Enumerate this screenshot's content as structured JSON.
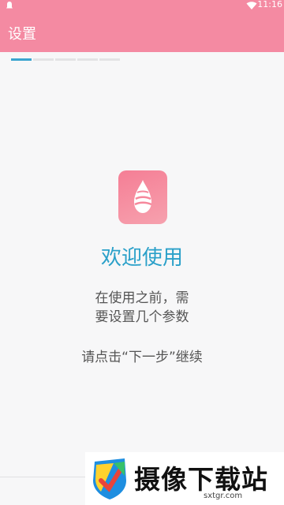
{
  "status_bar": {
    "time": "11:16",
    "left_icon": "notification-icon",
    "wifi_icon": "wifi-icon",
    "color": "#f48aa2"
  },
  "app_bar": {
    "title": "设置",
    "background": "#f48aa2"
  },
  "progress": {
    "total_steps": 5,
    "current_step": 1,
    "active_color": "#3aa5cf"
  },
  "welcome": {
    "icon": "droplet-app-icon",
    "title": "欢迎使用",
    "description_line1": "在使用之前，需",
    "description_line2": "要设置几个参数",
    "hint": "请点击“下一步”继续"
  },
  "watermark": {
    "logo": "shield-logo-icon",
    "title": "摄像下载站",
    "url": "sxtgr.com"
  }
}
